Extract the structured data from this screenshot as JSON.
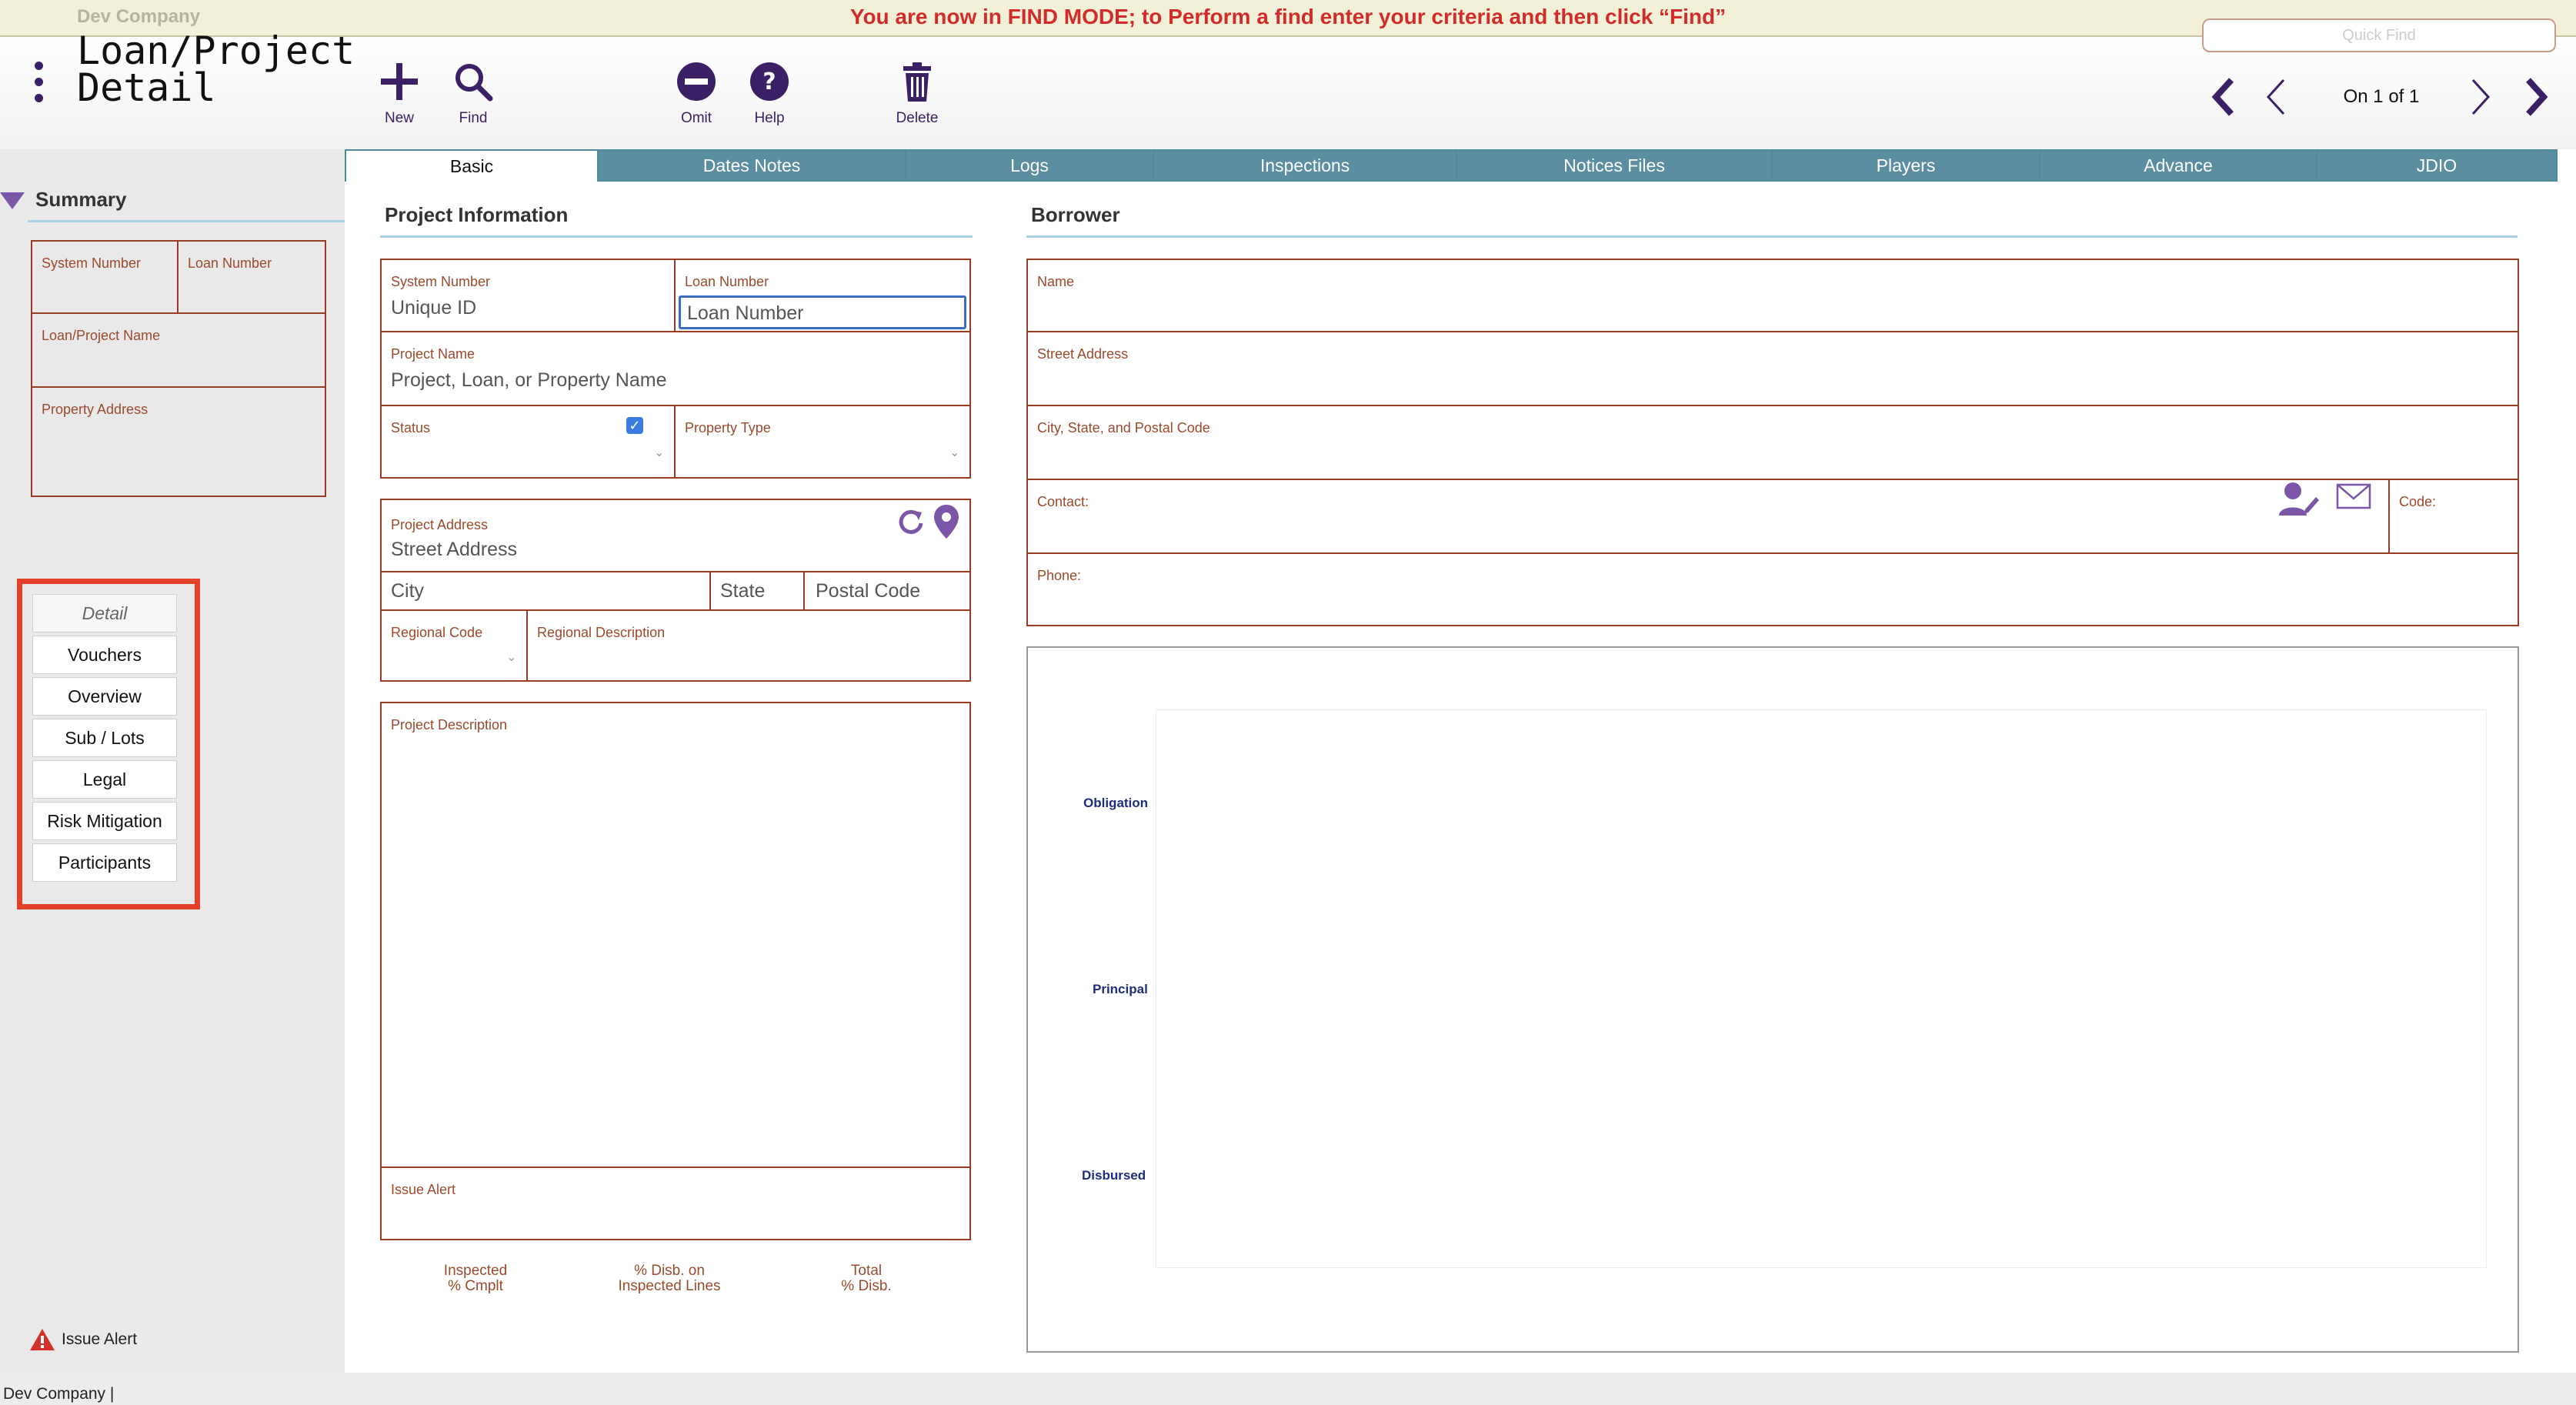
{
  "banner": {
    "company": "Dev Company",
    "message": "You are now in FIND MODE; to Perform a find enter your criteria and then click “Find”"
  },
  "header": {
    "title_line1": "Loan/Project",
    "title_line2": "Detail",
    "tools": {
      "new": "New",
      "find": "Find",
      "omit": "Omit",
      "help": "Help",
      "delete": "Delete"
    },
    "quick_find_placeholder": "Quick Find",
    "record_count": "On 1 of 1",
    "accent_color": "#3b2066"
  },
  "tabs": [
    {
      "label": "Basic"
    },
    {
      "label": "Dates Notes"
    },
    {
      "label": "Logs"
    },
    {
      "label": "Inspections"
    },
    {
      "label": "Notices Files"
    },
    {
      "label": "Players"
    },
    {
      "label": "Advance"
    },
    {
      "label": "JDIO"
    }
  ],
  "sidebar": {
    "summary_title": "Summary",
    "fields": {
      "system_number": "System Number",
      "loan_number": "Loan Number",
      "loan_project_name": "Loan/Project Name",
      "property_address": "Property Address"
    },
    "nav": [
      {
        "label": "Detail"
      },
      {
        "label": "Vouchers"
      },
      {
        "label": "Overview"
      },
      {
        "label": "Sub / Lots"
      },
      {
        "label": "Legal"
      },
      {
        "label": "Risk Mitigation"
      },
      {
        "label": "Participants"
      }
    ],
    "issue_alert": "Issue Alert"
  },
  "project": {
    "title": "Project Information",
    "system_number": {
      "label": "System Number",
      "placeholder": "Unique ID"
    },
    "loan_number": {
      "label": "Loan Number",
      "placeholder": "Loan Number"
    },
    "project_name": {
      "label": "Project Name",
      "placeholder": "Project, Loan, or Property Name"
    },
    "status": {
      "label": "Status"
    },
    "property_type": {
      "label": "Property Type"
    },
    "project_address": {
      "label": "Project Address",
      "placeholder": "Street Address"
    },
    "city": "City",
    "state": "State",
    "postal_code": "Postal Code",
    "regional_code": {
      "label": "Regional Code"
    },
    "regional_description": {
      "label": "Regional Description"
    },
    "project_description": {
      "label": "Project Description"
    },
    "issue_alert": {
      "label": "Issue Alert"
    },
    "stats": [
      {
        "line1": "Inspected",
        "line2": "% Cmplt"
      },
      {
        "line1": "% Disb. on",
        "line2": "Inspected Lines"
      },
      {
        "line1": "Total",
        "line2": "% Disb."
      }
    ]
  },
  "borrower": {
    "title": "Borrower",
    "name": "Name",
    "street_address": "Street Address",
    "city_state_postal": "City, State, and Postal Code",
    "contact": "Contact:",
    "code": "Code:",
    "phone": "Phone:",
    "chart_labels": {
      "obligation": "Obligation",
      "principal": "Principal",
      "disbursed": "Disbursed"
    }
  },
  "footer": {
    "text": "Dev Company |"
  }
}
